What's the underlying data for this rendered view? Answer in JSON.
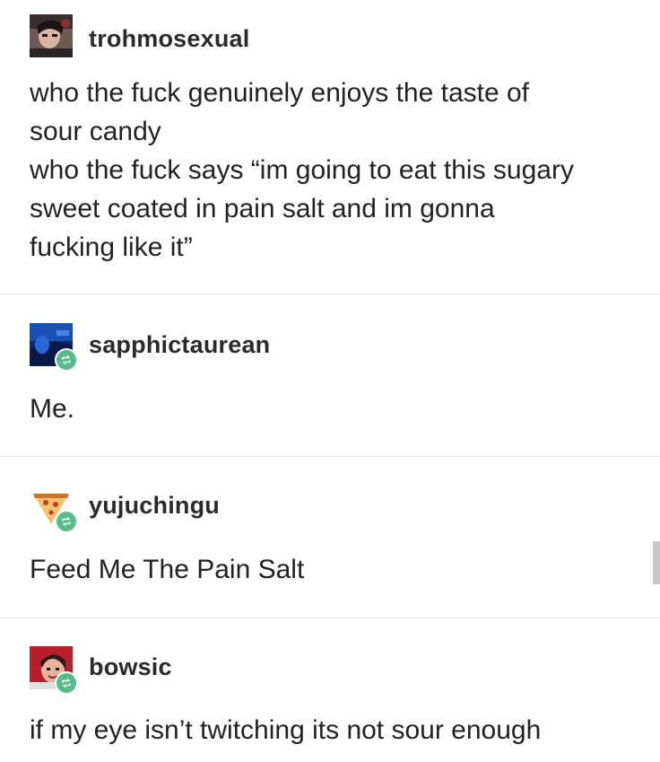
{
  "posts": [
    {
      "username": "trohmosexual",
      "avatar_icon": "user-avatar-icon",
      "reblog": false,
      "lines": [
        "who the fuck genuinely enjoys the taste of",
        "sour candy",
        "who the fuck says “im going to eat this sugary",
        "sweet coated in pain salt and im gonna",
        "fucking like it”"
      ]
    },
    {
      "username": "sapphictaurean",
      "avatar_icon": "user-avatar-icon",
      "reblog": true,
      "lines": [
        "Me."
      ]
    },
    {
      "username": "yujuchingu",
      "avatar_icon": "pizza-avatar-icon",
      "reblog": true,
      "lines": [
        "Feed Me The Pain Salt"
      ]
    },
    {
      "username": "bowsic",
      "avatar_icon": "user-avatar-icon",
      "reblog": true,
      "lines": [
        "if my eye isn’t twitching its not sour enough"
      ]
    }
  ],
  "colors": {
    "reblog_badge": "#56bc8a",
    "divider": "#e4e4e4",
    "text": "#222222"
  }
}
